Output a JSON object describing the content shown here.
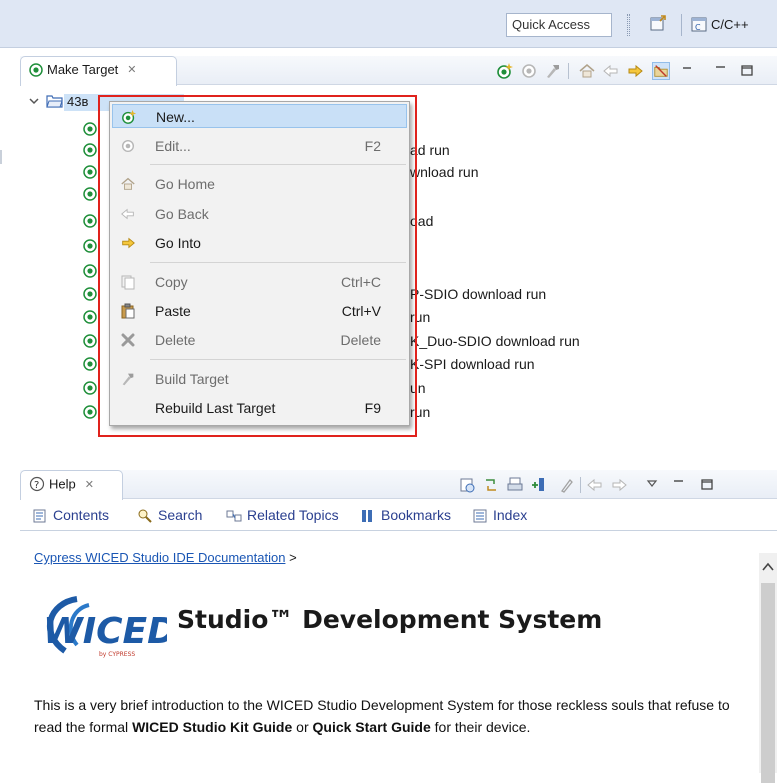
{
  "toolbar": {
    "quick_access_placeholder": "Quick Access",
    "perspective_label": "C/C++"
  },
  "make_target": {
    "tab_title": "Make Target",
    "root_label": "43в",
    "targets": [
      {
        "label": ""
      },
      {
        "label": "ad run"
      },
      {
        "label": "wnload run"
      },
      {
        "label": ""
      },
      {
        "label": "oad"
      },
      {
        "label": ""
      },
      {
        "label": ""
      },
      {
        "label": "P-SDIO download run"
      },
      {
        "label": "run"
      },
      {
        "label": "K_Duo-SDIO download run"
      },
      {
        "label": "K-SPI download run"
      },
      {
        "label": "un"
      },
      {
        "label": "run"
      }
    ]
  },
  "context_menu": {
    "items": [
      {
        "label": "New...",
        "shortcut": ""
      },
      {
        "label": "Edit...",
        "shortcut": "F2"
      },
      {
        "label": "Go Home",
        "shortcut": ""
      },
      {
        "label": "Go Back",
        "shortcut": ""
      },
      {
        "label": "Go Into",
        "shortcut": ""
      },
      {
        "label": "Copy",
        "shortcut": "Ctrl+C"
      },
      {
        "label": "Paste",
        "shortcut": "Ctrl+V"
      },
      {
        "label": "Delete",
        "shortcut": "Delete"
      },
      {
        "label": "Build Target",
        "shortcut": ""
      },
      {
        "label": "Rebuild Last Target",
        "shortcut": "F9"
      }
    ]
  },
  "help": {
    "tab_title": "Help",
    "nav": {
      "contents": "Contents",
      "search": "Search",
      "related": "Related Topics",
      "bookmarks": "Bookmarks",
      "index": "Index"
    },
    "breadcrumb_link": "Cypress WICED Studio IDE Documentation",
    "breadcrumb_sep": ">",
    "logo_text": "WICED",
    "logo_sub": "by CYPRESS",
    "heading": "Studio™ Development System",
    "intro": {
      "p1": "This is a very brief introduction to the WICED Studio Development System for those reckless souls that refuse to read the formal ",
      "b1": "WICED Studio Kit Guide",
      "p2": " or ",
      "b2": "Quick Start Guide",
      "p3": " for their device."
    }
  },
  "colors": {
    "toolbar_bg": "#dfe7f4",
    "menu_highlight": "#c9e0f7",
    "annotation_outline": "#e0221c",
    "link": "#1a56b4",
    "target_green": "#1f8f3a"
  }
}
